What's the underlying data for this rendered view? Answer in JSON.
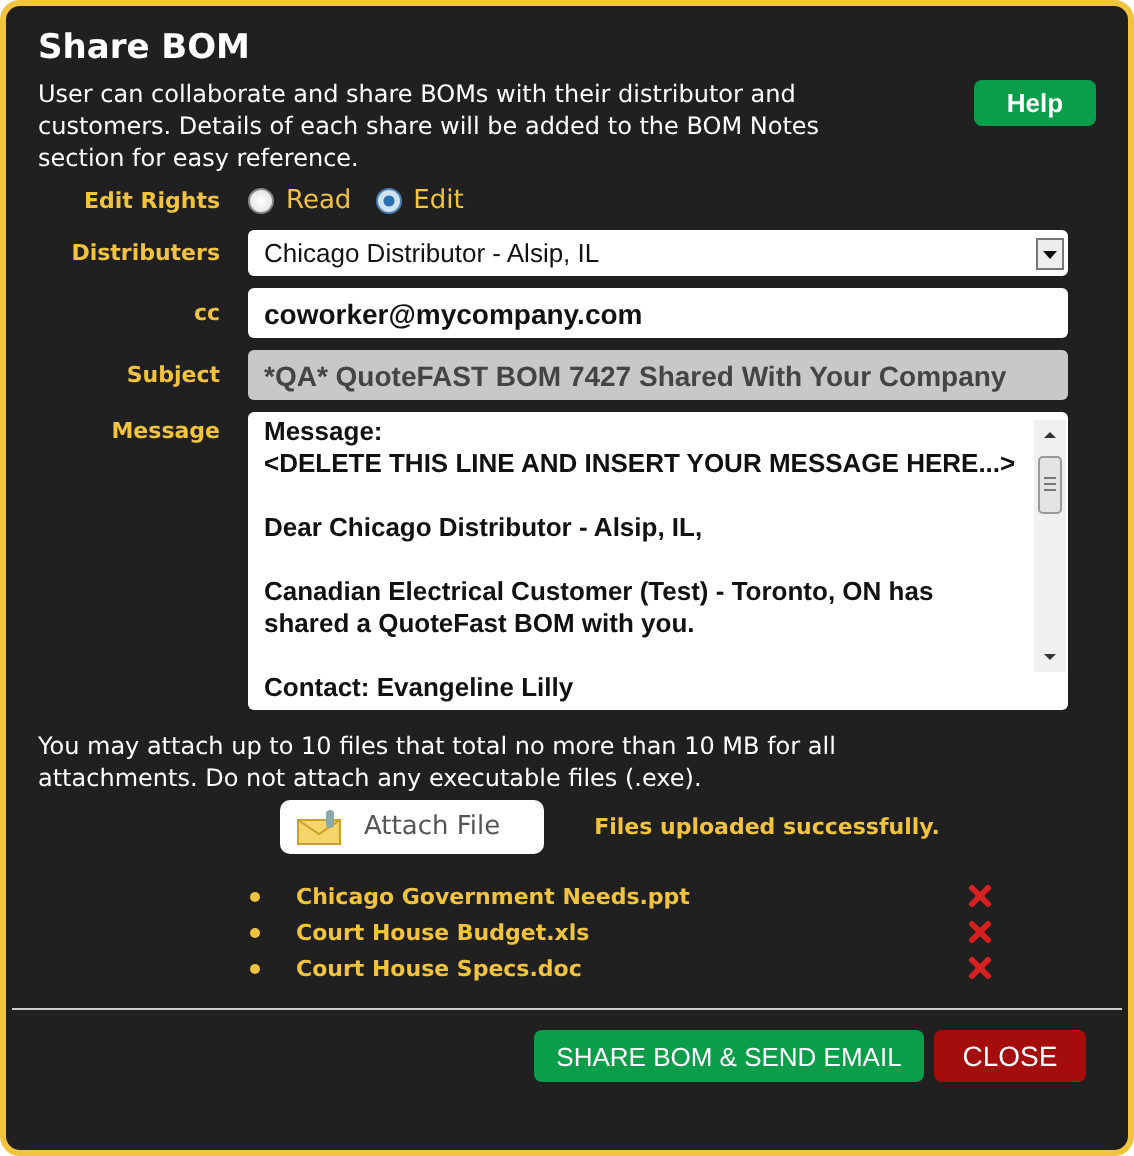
{
  "dialog": {
    "title": "Share BOM",
    "description": "User can collaborate and share BOMs with their distributor and customers. Details of each share will be added to the BOM Notes section for easy reference.",
    "help_button": "Help"
  },
  "form": {
    "edit_rights": {
      "label": "Edit Rights",
      "options": [
        {
          "label": "Read",
          "selected": false
        },
        {
          "label": "Edit",
          "selected": true
        }
      ]
    },
    "distributers": {
      "label": "Distributers",
      "value": "Chicago Distributor - Alsip, IL"
    },
    "cc": {
      "label": "cc",
      "value": "coworker@mycompany.com"
    },
    "subject": {
      "label": "Subject",
      "value": "*QA* QuoteFAST BOM 7427 Shared With Your Company",
      "disabled": true
    },
    "message": {
      "label": "Message",
      "paragraphs": [
        [
          "Message:",
          "<DELETE THIS LINE AND INSERT YOUR MESSAGE HERE...>"
        ],
        [
          "Dear Chicago Distributor - Alsip, IL,"
        ],
        [
          "Canadian Electrical Customer (Test) - Toronto, ON has shared a QuoteFast BOM with you."
        ],
        [
          "Contact: Evangeline Lilly"
        ]
      ]
    }
  },
  "attachments": {
    "note": "You may attach up to 10 files that total no more than 10 MB for all attachments. Do not attach any executable files (.exe).",
    "attach_button": "Attach File",
    "status": "Files uploaded successfully.",
    "files": [
      "Chicago Government Needs.ppt",
      "Court House Budget.xls",
      "Court House Specs.doc"
    ]
  },
  "buttons": [
    {
      "label": "SHARE BOM & SEND EMAIL",
      "kind": "primary"
    },
    {
      "label": "CLOSE",
      "kind": "danger"
    }
  ]
}
